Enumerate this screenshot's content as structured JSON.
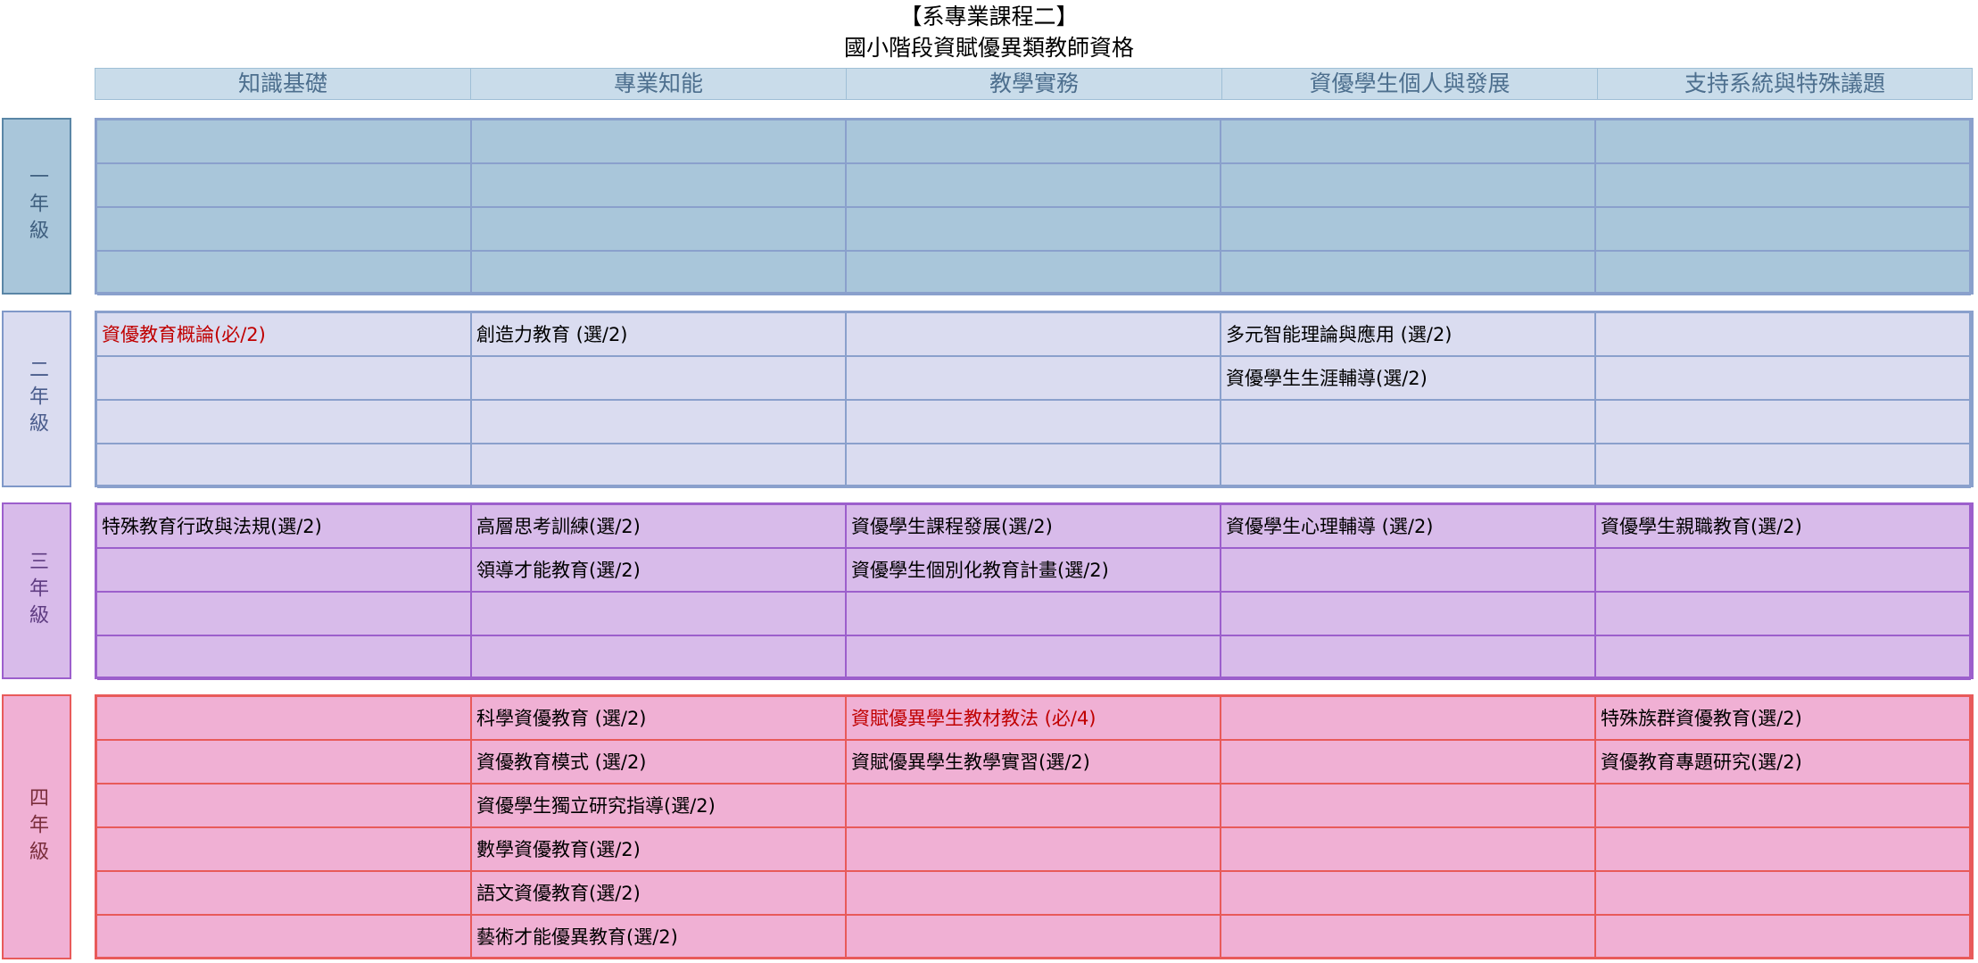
{
  "title_line1": "【系專業課程二】",
  "title_line2": "國小階段資賦優異類教師資格",
  "columns": [
    "知識基礎",
    "專業知能",
    "教學實務",
    "資優學生個人與發展",
    "支持系統與特殊議題"
  ],
  "years": [
    {
      "label": "一年級",
      "rows": [
        [
          "",
          "",
          "",
          "",
          ""
        ],
        [
          "",
          "",
          "",
          "",
          ""
        ],
        [
          "",
          "",
          "",
          "",
          ""
        ],
        [
          "",
          "",
          "",
          "",
          ""
        ]
      ]
    },
    {
      "label": "二年級",
      "rows": [
        [
          "資優教育概論(必/2)",
          "創造力教育 (選/2)",
          "",
          "多元智能理論與應用 (選/2)",
          ""
        ],
        [
          "",
          "",
          "",
          "資優學生生涯輔導(選/2)",
          ""
        ],
        [
          "",
          "",
          "",
          "",
          ""
        ],
        [
          "",
          "",
          "",
          "",
          ""
        ]
      ]
    },
    {
      "label": "三年級",
      "rows": [
        [
          "特殊教育行政與法規(選/2)",
          "高層思考訓練(選/2)",
          "資優學生課程發展(選/2)",
          "資優學生心理輔導 (選/2)",
          "資優學生親職教育(選/2)"
        ],
        [
          "",
          "領導才能教育(選/2)",
          "資優學生個別化教育計畫(選/2)",
          "",
          ""
        ],
        [
          "",
          "",
          "",
          "",
          ""
        ],
        [
          "",
          "",
          "",
          "",
          ""
        ]
      ]
    },
    {
      "label": "四年級",
      "rows": [
        [
          "",
          "科學資優教育 (選/2)",
          "資賦優異學生教材教法 (必/4)",
          "",
          "特殊族群資優教育(選/2)"
        ],
        [
          "",
          "資優教育模式 (選/2)",
          "資賦優異學生教學實習(選/2)",
          "",
          "資優教育專題研究(選/2)"
        ],
        [
          "",
          "資優學生獨立研究指導(選/2)",
          "",
          "",
          ""
        ],
        [
          "",
          "數學資優教育(選/2)",
          "",
          "",
          ""
        ],
        [
          "",
          "語文資優教育(選/2)",
          "",
          "",
          ""
        ],
        [
          "",
          "藝術才能優異教育(選/2)",
          "",
          "",
          ""
        ]
      ]
    }
  ],
  "required_color": "#c00000"
}
